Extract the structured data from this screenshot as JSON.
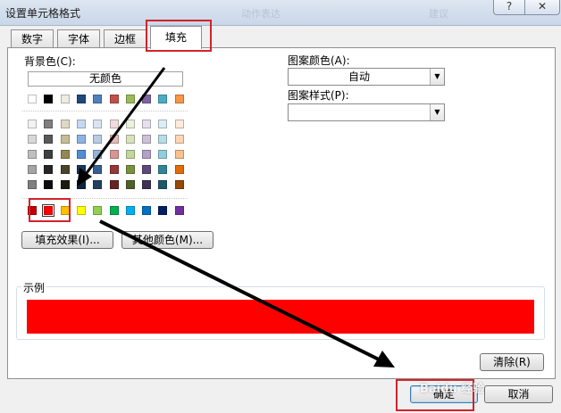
{
  "window": {
    "title": "设置单元格格式",
    "faint_text_1": "动作表达",
    "faint_text_2": "建议",
    "help_label": "?",
    "close_label": "✕"
  },
  "tabs": [
    {
      "label": "数字",
      "active": false
    },
    {
      "label": "字体",
      "active": false
    },
    {
      "label": "边框",
      "active": false
    },
    {
      "label": "填充",
      "active": true
    }
  ],
  "fill": {
    "background_color_label": "背景色(C):",
    "no_color_label": "无颜色",
    "theme_row": [
      "#ffffff",
      "#000000",
      "#eeece1",
      "#1f497d",
      "#4f81bd",
      "#c0504d",
      "#9bbb59",
      "#8064a2",
      "#4bacc6",
      "#f79646"
    ],
    "tint_rows": [
      [
        "#f2f2f2",
        "#7f7f7f",
        "#ddd9c3",
        "#c6d9f0",
        "#dbe5f1",
        "#f2dcdb",
        "#ebf1dd",
        "#e5e0ec",
        "#dbeef3",
        "#fdeada"
      ],
      [
        "#d8d8d8",
        "#595959",
        "#c4bd97",
        "#8db3e2",
        "#b8cce4",
        "#e5b9b7",
        "#d7e3bc",
        "#ccc1d9",
        "#b7dde8",
        "#fbd5b5"
      ],
      [
        "#bfbfbf",
        "#3f3f3f",
        "#938953",
        "#548dd4",
        "#95b3d7",
        "#d99694",
        "#c3d69b",
        "#b2a2c7",
        "#92cddc",
        "#fac08f"
      ],
      [
        "#a5a5a5",
        "#262626",
        "#494429",
        "#17365d",
        "#366092",
        "#953734",
        "#76923c",
        "#5f497a",
        "#31859b",
        "#e36c09"
      ],
      [
        "#7f7f7f",
        "#0c0c0c",
        "#1d1b10",
        "#0f243e",
        "#244061",
        "#632423",
        "#4f6128",
        "#3f3151",
        "#205867",
        "#974806"
      ]
    ],
    "standard_row": [
      "#c00000",
      "#ff0000",
      "#ffc000",
      "#ffff00",
      "#92d050",
      "#00b050",
      "#00b0f0",
      "#0070c0",
      "#002060",
      "#7030a0"
    ],
    "selected_color": "#ff0000",
    "fill_effects_button": "填充效果(I)...",
    "more_colors_button": "其他颜色(M)...",
    "pattern_color_label": "图案颜色(A):",
    "pattern_color_value": "自动",
    "pattern_style_label": "图案样式(P):",
    "pattern_style_value": "",
    "sample_label": "示例",
    "clear_button": "清除(R)"
  },
  "footer": {
    "ok_button": "确定",
    "cancel_button": "取消"
  },
  "watermark": "Baidu 经验",
  "colors": {
    "annotation_red": "#d2232a",
    "title_bar": "#dde6f1"
  }
}
